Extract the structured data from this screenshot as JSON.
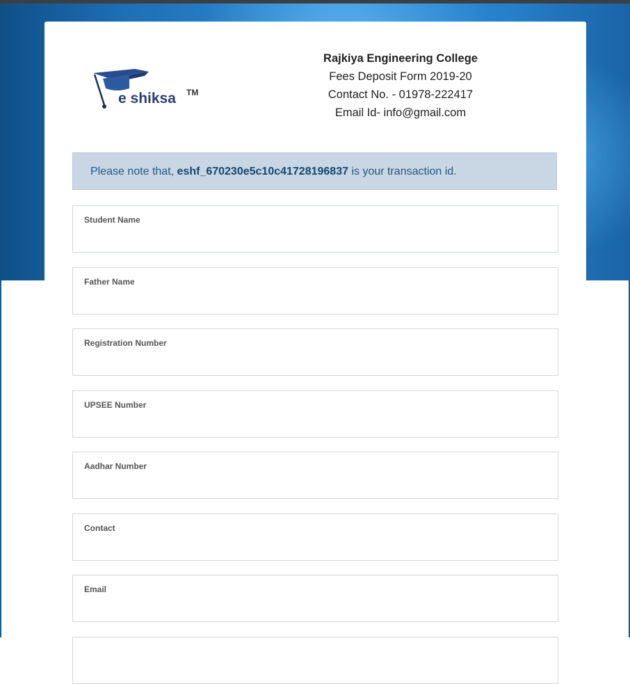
{
  "header": {
    "logo_text": "e shiksa",
    "logo_tm": "TM",
    "college_name": "Rajkiya Engineering College",
    "form_title": "Fees Deposit Form 2019-20",
    "contact": "Contact No. - 01978-222417",
    "email": "Email Id- info@gmail.com"
  },
  "notice": {
    "prefix": "Please note that, ",
    "transaction_id": "eshf_670230e5c10c41728196837",
    "suffix": " is your transaction id."
  },
  "fields": [
    {
      "label": "Student Name",
      "value": ""
    },
    {
      "label": "Father Name",
      "value": ""
    },
    {
      "label": "Registration Number",
      "value": ""
    },
    {
      "label": "UPSEE Number",
      "value": ""
    },
    {
      "label": "Aadhar Number",
      "value": ""
    },
    {
      "label": "Contact",
      "value": ""
    },
    {
      "label": "Email",
      "value": ""
    }
  ],
  "colors": {
    "hero_blue": "#2d8ad4",
    "notice_bg": "#c9d6e3",
    "notice_text": "#1f5785"
  }
}
